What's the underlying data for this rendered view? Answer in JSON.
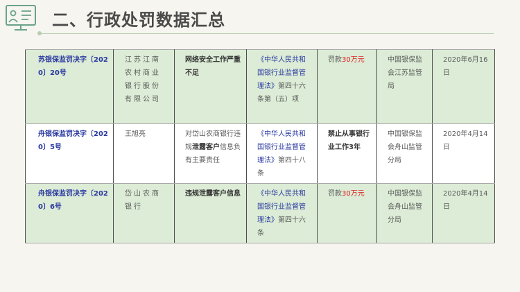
{
  "title": "二、行政处罚数据汇总",
  "colors": {
    "accent_green": "#6aa38a",
    "row_shade": "#dcecd6",
    "link_blue": "#2b3aa0",
    "fine_red": "#e02020"
  },
  "rows": [
    {
      "decision_no": "苏银保监罚决字〔2020〕20号",
      "party": "江苏江南农村商业银行股份有限公司",
      "violation": "网络安全工作严重不足",
      "basis_link": "《中华人民共和国银行业监督管理法》",
      "basis_rest": "第四十六条第（五）项",
      "penalty_prefix": "罚款",
      "penalty_amount": "30万元",
      "penalty_bold": "",
      "authority": "中国银保监会江苏监管局",
      "date": "2020年6月16日"
    },
    {
      "decision_no": "舟银保监罚决字〔2020〕5号",
      "party": "王旭亮",
      "violation_pre": "对岱山农商银行违规",
      "violation_bold": "泄露客户",
      "violation_post": "信息负有主要责任",
      "basis_link": "《中华人民共和国银行业监督管理法》",
      "basis_rest": "第四十八条",
      "penalty_bold": "禁止从事银行业工作3年",
      "authority": "中国银保监会舟山监管分局",
      "date": "2020年4月14日"
    },
    {
      "decision_no": "舟银保监罚决字〔2020〕6号",
      "party": "岱山农商银行",
      "violation": "违规泄露客户信息",
      "basis_link": "《中华人民共和国银行业监督管理法》",
      "basis_rest": "第四十六条",
      "penalty_prefix": "罚款",
      "penalty_amount": "30万元",
      "authority": "中国银保监会舟山监管分局",
      "date": "2020年4月14日"
    }
  ]
}
